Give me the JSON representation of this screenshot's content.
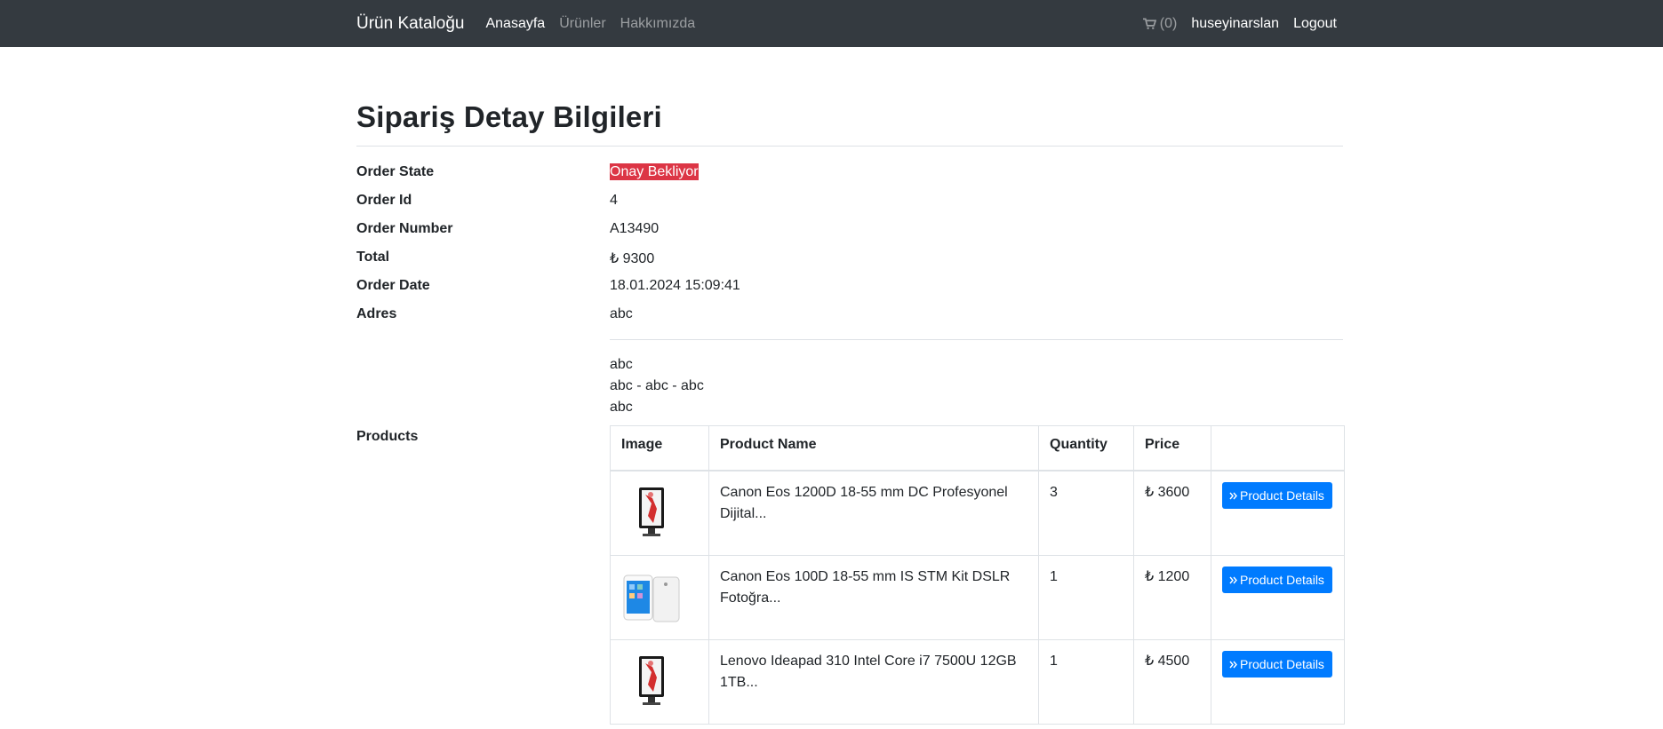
{
  "navbar": {
    "brand": "Ürün Kataloğu",
    "links": [
      "Anasayfa",
      "Ürünler",
      "Hakkımızda"
    ],
    "cart_count": "(0)",
    "username": "huseyinarslan",
    "logout": "Logout"
  },
  "page": {
    "title": "Sipariş Detay Bilgileri",
    "fields": {
      "order_state_label": "Order State",
      "order_state_value": "Onay Bekliyor",
      "order_id_label": "Order Id",
      "order_id_value": "4",
      "order_number_label": "Order Number",
      "order_number_value": "A13490",
      "total_label": "Total",
      "total_value": "₺ 9300",
      "order_date_label": "Order Date",
      "order_date_value": "18.01.2024 15:09:41",
      "address_label": "Adres",
      "address_value": "abc"
    },
    "address_lines": [
      "abc",
      "abc - abc - abc",
      "abc"
    ],
    "products_label": "Products"
  },
  "table": {
    "headers": [
      "Image",
      "Product Name",
      "Quantity",
      "Price",
      ""
    ],
    "rows": [
      {
        "image": "monitor-image",
        "name": "Canon Eos 1200D 18-55 mm DC Profesyonel Dijital...",
        "quantity": "3",
        "price": "₺ 3600",
        "button": "Product Details"
      },
      {
        "image": "tablet-image",
        "name": "Canon Eos 100D 18-55 mm IS STM Kit DSLR Fotoğra...",
        "quantity": "1",
        "price": "₺ 1200",
        "button": "Product Details"
      },
      {
        "image": "monitor-image",
        "name": "Lenovo Ideapad 310 Intel Core i7 7500U 12GB 1TB...",
        "quantity": "1",
        "price": "₺ 4500",
        "button": "Product Details"
      }
    ]
  },
  "colors": {
    "navbar": "#343a40",
    "badge": "#dc3545",
    "button": "#007bff"
  }
}
